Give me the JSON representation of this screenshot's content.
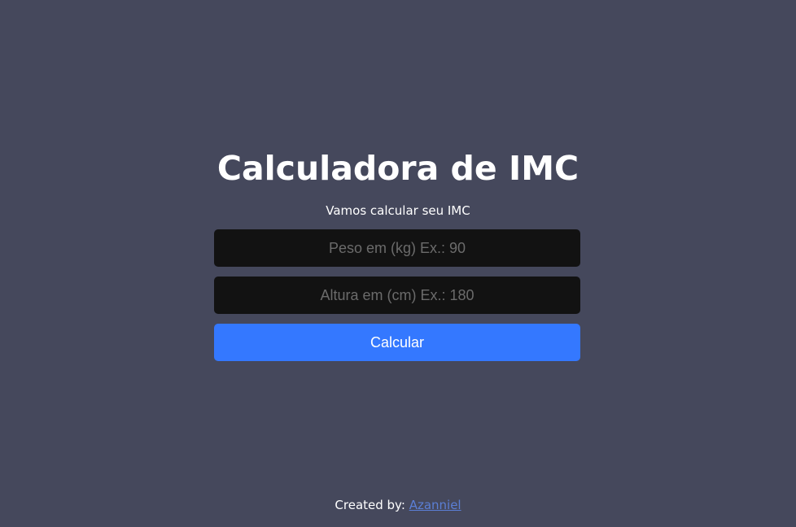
{
  "page": {
    "title": "Calculadora de IMC",
    "subtitle": "Vamos calcular seu IMC"
  },
  "form": {
    "weight_placeholder": "Peso em (kg) Ex.: 90",
    "weight_value": "",
    "height_placeholder": "Altura em (cm) Ex.: 180",
    "height_value": "",
    "submit_label": "Calcular"
  },
  "footer": {
    "created_by_label": "Created by:",
    "author_link": "Azanniel"
  },
  "colors": {
    "background": "#45485c",
    "input_background": "#121212",
    "button": "#3478ff",
    "link": "#5b7fd6"
  }
}
